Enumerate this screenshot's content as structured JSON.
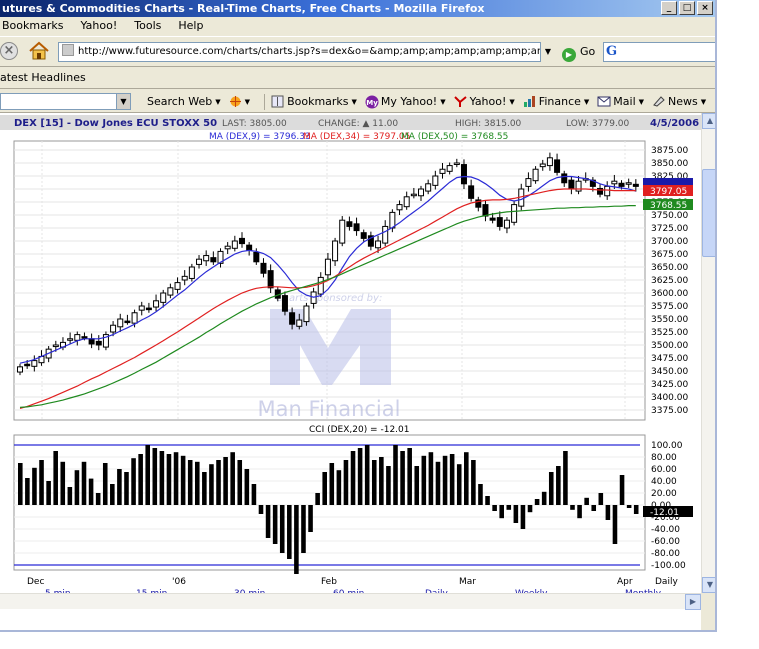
{
  "window": {
    "title": "utures & Commodities Charts - Real-Time Charts, Free Charts - Mozilla Firefox",
    "min": "_",
    "max": "□",
    "close": "×"
  },
  "menu": {
    "items": [
      "Bookmarks",
      "Yahoo!",
      "Tools",
      "Help"
    ]
  },
  "nav": {
    "url": "http://www.futuresource.com/charts/charts.jsp?s=dex&o=&amp;amp;amp;amp;amp;amp;amp;amp;a=Dx",
    "go_label": "Go",
    "search_logo": "G"
  },
  "headlines": {
    "label": "atest Headlines"
  },
  "yahoo_toolbar": {
    "items": [
      "Search Web",
      "Bookmarks",
      "My Yahoo!",
      "Yahoo!",
      "Finance",
      "Mail",
      "News"
    ]
  },
  "chart_header": {
    "symbol": "DEX [15] - Dow Jones ECU STOXX 50",
    "last": "LAST: 3805.00",
    "change": "CHANGE: ▲ 11.00",
    "high": "HIGH: 3815.00",
    "low": "LOW: 3779.00",
    "date": "4/5/2006",
    "ma9": "MA (DEX,9) = 3796.33",
    "ma34": "MA (DEX,34) = 3797.05",
    "ma50": "MA (DEX,50) = 3768.55",
    "cci_title": "CCI (DEX,20) = -12.01"
  },
  "watermark": {
    "top": "Charts sponsored by:",
    "brand": "Man Financial"
  },
  "timeframes": [
    "5 min",
    "15 min",
    "30 min",
    "60 min",
    "Daily",
    "Weekly",
    "Monthly"
  ],
  "colors": {
    "ma9": "#2b2bd6",
    "ma34": "#e02020",
    "ma50": "#1f8a1f",
    "cci_line": "#2b2bd6",
    "watermark": "#c9cdea"
  },
  "chart_data": [
    {
      "type": "line",
      "title": "DEX [15] - Dow Jones ECU STOXX 50",
      "ylim": [
        3375,
        3875
      ],
      "yticks": [
        3875,
        3850,
        3825,
        3800,
        3775,
        3750,
        3725,
        3700,
        3675,
        3650,
        3625,
        3600,
        3575,
        3550,
        3525,
        3500,
        3475,
        3450,
        3425,
        3400,
        3375
      ],
      "xticks": [
        "Dec",
        "'06",
        "Feb",
        "Mar",
        "Apr",
        "Daily"
      ],
      "last_value_labels": [
        "3797.05",
        "3768.55"
      ],
      "close": [
        3458,
        3462,
        3470,
        3478,
        3492,
        3500,
        3505,
        3512,
        3520,
        3515,
        3502,
        3500,
        3520,
        3538,
        3550,
        3545,
        3562,
        3575,
        3568,
        3585,
        3600,
        3610,
        3620,
        3632,
        3650,
        3665,
        3672,
        3660,
        3680,
        3690,
        3700,
        3695,
        3682,
        3660,
        3638,
        3610,
        3590,
        3565,
        3540,
        3548,
        3575,
        3602,
        3630,
        3665,
        3700,
        3740,
        3728,
        3720,
        3705,
        3690,
        3700,
        3728,
        3755,
        3770,
        3785,
        3790,
        3800,
        3810,
        3825,
        3838,
        3845,
        3850,
        3810,
        3782,
        3765,
        3748,
        3740,
        3728,
        3740,
        3770,
        3800,
        3820,
        3838,
        3848,
        3860,
        3832,
        3812,
        3800,
        3815,
        3820,
        3805,
        3790,
        3805,
        3815,
        3805,
        3812,
        3805
      ],
      "series": [
        {
          "name": "MA (DEX,9)",
          "values": [
            3465,
            3468,
            3472,
            3478,
            3484,
            3490,
            3496,
            3502,
            3508,
            3512,
            3512,
            3512,
            3515,
            3520,
            3527,
            3533,
            3540,
            3548,
            3555,
            3564,
            3574,
            3585,
            3596,
            3606,
            3618,
            3630,
            3641,
            3650,
            3659,
            3667,
            3675,
            3680,
            3682,
            3680,
            3676,
            3668,
            3654,
            3638,
            3620,
            3604,
            3596,
            3592,
            3595,
            3607,
            3625,
            3648,
            3670,
            3686,
            3698,
            3706,
            3712,
            3718,
            3726,
            3735,
            3746,
            3756,
            3766,
            3777,
            3789,
            3801,
            3813,
            3822,
            3824,
            3823,
            3818,
            3810,
            3800,
            3788,
            3780,
            3777,
            3780,
            3787,
            3796,
            3806,
            3816,
            3822,
            3824,
            3824,
            3822,
            3820,
            3816,
            3810,
            3806,
            3804,
            3802,
            3800,
            3796
          ]
        },
        {
          "name": "MA (DEX,34)",
          "values": [
            3378,
            3382,
            3387,
            3392,
            3397,
            3403,
            3409,
            3415,
            3421,
            3428,
            3435,
            3441,
            3448,
            3455,
            3462,
            3469,
            3476,
            3484,
            3492,
            3500,
            3508,
            3517,
            3525,
            3534,
            3543,
            3552,
            3561,
            3570,
            3578,
            3586,
            3593,
            3600,
            3605,
            3609,
            3611,
            3612,
            3612,
            3611,
            3610,
            3610,
            3611,
            3614,
            3618,
            3624,
            3632,
            3641,
            3650,
            3659,
            3667,
            3674,
            3681,
            3688,
            3695,
            3702,
            3709,
            3716,
            3723,
            3730,
            3738,
            3746,
            3754,
            3762,
            3768,
            3773,
            3776,
            3778,
            3779,
            3779,
            3780,
            3782,
            3785,
            3788,
            3791,
            3794,
            3797,
            3799,
            3800,
            3800,
            3800,
            3800,
            3799,
            3798,
            3798,
            3797,
            3797,
            3797,
            3797
          ]
        },
        {
          "name": "MA (DEX,50)",
          "values": [
            3380,
            3381,
            3383,
            3385,
            3388,
            3391,
            3394,
            3398,
            3402,
            3406,
            3411,
            3416,
            3421,
            3427,
            3433,
            3439,
            3446,
            3453,
            3460,
            3467,
            3475,
            3483,
            3491,
            3499,
            3507,
            3515,
            3524,
            3532,
            3541,
            3549,
            3557,
            3565,
            3572,
            3579,
            3585,
            3591,
            3596,
            3601,
            3605,
            3609,
            3613,
            3617,
            3621,
            3626,
            3631,
            3637,
            3643,
            3649,
            3655,
            3661,
            3667,
            3673,
            3679,
            3685,
            3691,
            3697,
            3703,
            3709,
            3715,
            3721,
            3727,
            3733,
            3738,
            3742,
            3746,
            3749,
            3752,
            3754,
            3756,
            3757,
            3758,
            3759,
            3760,
            3761,
            3762,
            3763,
            3763,
            3764,
            3764,
            3765,
            3765,
            3766,
            3766,
            3767,
            3767,
            3768,
            3768
          ]
        }
      ]
    },
    {
      "type": "bar",
      "title": "CCI (DEX,20) = -12.01",
      "ylim": [
        -100,
        100
      ],
      "yticks": [
        100.0,
        80.0,
        60.0,
        40.0,
        20.0,
        0.0,
        -20.0,
        -40.0,
        -60.0,
        -80.0,
        -100.0
      ],
      "ytick_labels": [
        "100.00",
        "80.00",
        "60.00",
        "40.00",
        "20.00",
        "0.00",
        "-20.00",
        "-40.00",
        "-60.00",
        "-80.00",
        "-100.00"
      ],
      "last_value_label": "-12.01",
      "values": [
        70,
        45,
        62,
        75,
        40,
        90,
        72,
        30,
        58,
        72,
        44,
        20,
        70,
        35,
        60,
        55,
        78,
        85,
        100,
        95,
        90,
        85,
        88,
        82,
        75,
        72,
        55,
        68,
        75,
        80,
        88,
        75,
        60,
        35,
        -15,
        -55,
        -65,
        -80,
        -90,
        -115,
        -80,
        -45,
        20,
        55,
        70,
        58,
        75,
        90,
        95,
        100,
        75,
        80,
        65,
        100,
        90,
        95,
        65,
        82,
        88,
        72,
        82,
        85,
        68,
        88,
        75,
        35,
        15,
        -10,
        -22,
        -8,
        -30,
        -40,
        -12,
        10,
        22,
        55,
        65,
        90,
        -8,
        -22,
        12,
        -10,
        20,
        -25,
        -65,
        50,
        -5,
        -15
      ]
    }
  ]
}
